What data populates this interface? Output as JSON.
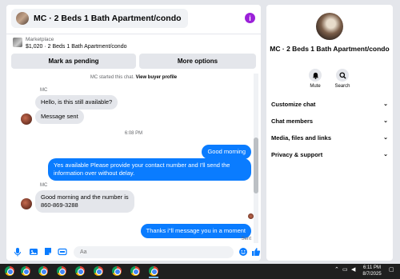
{
  "colors": {
    "accent": "#0a7cff",
    "info": "#9b20d9"
  },
  "header": {
    "title": "MC · 2 Beds 1 Bath Apartment/condo"
  },
  "listing": {
    "label": "Marketplace",
    "price_line": "$1,020 · 2 Beds 1 Bath Apartment/condo",
    "mark_pending": "Mark as pending",
    "more_options": "More options"
  },
  "thread": {
    "started_note": "MC started this chat.",
    "view_profile": "View buyer profile",
    "sender1": "MC",
    "msg1": "Hello, is this still available?",
    "msg2": "Message sent",
    "time": "6:08 PM",
    "msg3": "Good morning",
    "msg4": "Yes available Please provide your contact number and I'll send the information over without delay.",
    "sender2": "MC",
    "msg5a": "Good morning and the number is",
    "msg5b": "860-869-3288",
    "msg6": "Thanks i\"ll message you in a moment",
    "status": "Sent"
  },
  "composer": {
    "placeholder": "Aa"
  },
  "side": {
    "title": "MC · 2 Beds 1 Bath Apartment/condo",
    "mute": "Mute",
    "search": "Search",
    "menu": [
      "Customize chat",
      "Chat members",
      "Media, files and links",
      "Privacy & support"
    ]
  },
  "taskbar": {
    "time": "6:11 PM",
    "date": "8/7/2025"
  }
}
